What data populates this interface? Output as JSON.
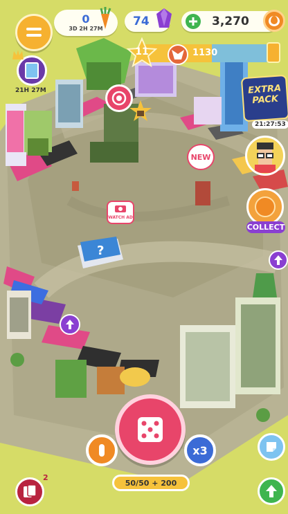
{
  "hud": {
    "timer_value": "0",
    "timer_countdown": "3D 2H 27M",
    "gems": "74",
    "coins": "3,270",
    "level": "11",
    "xp_value": "1130",
    "xp_progress": 0.55
  },
  "left_panel": {
    "card_timer": "21H 27M"
  },
  "right_panel": {
    "extra_pack_line1": "EXTRA",
    "extra_pack_line2": "PACK",
    "extra_pack_timer": "21:27:53",
    "collect_label": "COLLECT"
  },
  "board": {
    "new_badge": "NEW",
    "watch_ad_label": "WATCH AD"
  },
  "bottom": {
    "dice_multiplier": "x3",
    "rolls_label": "50/50 + 200",
    "cards_badge_count": "2"
  },
  "colors": {
    "accent_pink": "#e8456a",
    "hud_blue": "#3b6bd6",
    "gem_purple": "#8a3fd1",
    "coin_orange": "#f08a24",
    "ground_yellow": "#d9e06a",
    "board_gray": "#a9a58a"
  }
}
